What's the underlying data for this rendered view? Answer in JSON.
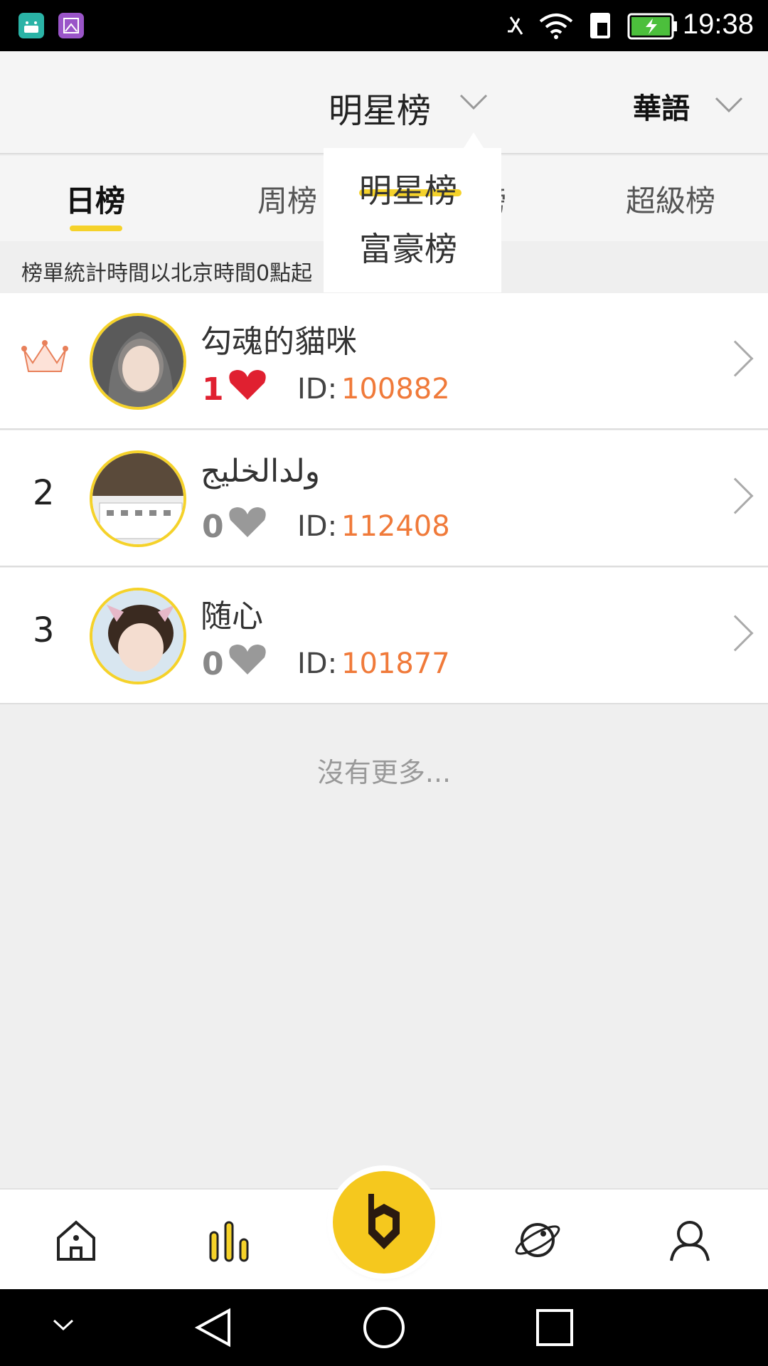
{
  "status_bar": {
    "time": "19:38",
    "icons": [
      "android-icon",
      "gallery-icon",
      "mute-icon",
      "wifi-icon",
      "sim-icon",
      "battery-charging-icon"
    ]
  },
  "header": {
    "title": "明星榜",
    "language": "華語"
  },
  "tabs": [
    {
      "label": "日榜",
      "active": true
    },
    {
      "label": "周榜",
      "active": false
    },
    {
      "label": "榜",
      "active": false
    },
    {
      "label": "超級榜",
      "active": false
    }
  ],
  "notice": "榜單統計時間以北京時間0點起",
  "dropdown": {
    "items": [
      "明星榜",
      "富豪榜"
    ],
    "selected": "明星榜"
  },
  "list": [
    {
      "rank": "",
      "name": "勾魂的貓咪",
      "level": "1",
      "id_label": "ID:",
      "id": "100882"
    },
    {
      "rank": "2",
      "name": "ولدالخليج",
      "level": "0",
      "id_label": "ID:",
      "id": "112408"
    },
    {
      "rank": "3",
      "name": "随心",
      "level": "0",
      "id_label": "ID:",
      "id": "101877"
    }
  ],
  "footer_text": "沒有更多...",
  "bottom_nav": [
    "home-icon",
    "chart-icon",
    "live-center-icon",
    "planet-icon",
    "profile-icon"
  ],
  "colors": {
    "accent": "#f5d22a",
    "id_color": "#f07a3a",
    "heart_red": "#e02030",
    "heart_gray": "#888888"
  }
}
